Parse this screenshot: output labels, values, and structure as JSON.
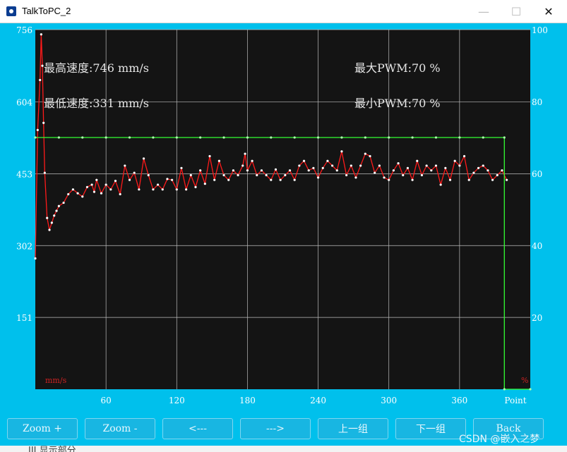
{
  "window": {
    "title": "TalkToPC_2",
    "controls": {
      "minimize": "—",
      "maximize": "☐",
      "close": "✕"
    }
  },
  "stats": {
    "max_speed": "最高速度:746 mm/s",
    "min_speed": "最低速度:331 mm/s",
    "max_pwm": "最大PWM:70 %",
    "min_pwm": "最小PWM:70 %"
  },
  "chart_data": {
    "type": "line",
    "left_axis": {
      "unit_label": "mm/s",
      "ticks": [
        "151",
        "302",
        "453",
        "604",
        "756"
      ],
      "range": [
        0,
        756
      ]
    },
    "right_axis": {
      "unit_label": "%",
      "ticks": [
        "20",
        "40",
        "60",
        "80",
        "100"
      ],
      "range": [
        0,
        100
      ]
    },
    "x_axis": {
      "ticks": [
        "60",
        "120",
        "180",
        "240",
        "300",
        "360"
      ],
      "end_label": "Point",
      "range": [
        0,
        420
      ]
    },
    "grid": true,
    "series": [
      {
        "axis": "left",
        "color": "#ff1a1a",
        "x": [
          0,
          2,
          4,
          5,
          6,
          7,
          8,
          10,
          12,
          14,
          16,
          18,
          20,
          24,
          28,
          32,
          36,
          40,
          44,
          48,
          50,
          52,
          56,
          60,
          64,
          68,
          72,
          76,
          80,
          84,
          88,
          92,
          96,
          100,
          104,
          108,
          112,
          116,
          120,
          124,
          128,
          132,
          136,
          140,
          144,
          148,
          152,
          156,
          160,
          164,
          168,
          172,
          176,
          178,
          180,
          184,
          188,
          192,
          196,
          200,
          204,
          208,
          212,
          216,
          220,
          224,
          228,
          232,
          236,
          240,
          244,
          248,
          252,
          256,
          260,
          264,
          268,
          272,
          276,
          280,
          284,
          288,
          292,
          296,
          300,
          304,
          308,
          312,
          316,
          320,
          324,
          328,
          332,
          336,
          340,
          344,
          348,
          352,
          356,
          360,
          364,
          368,
          372,
          376,
          380,
          384,
          388,
          392,
          396,
          400
        ],
        "y": [
          275,
          545,
          650,
          746,
          680,
          560,
          455,
          360,
          335,
          350,
          365,
          375,
          385,
          392,
          410,
          420,
          412,
          405,
          425,
          430,
          415,
          440,
          412,
          430,
          420,
          438,
          410,
          470,
          440,
          455,
          420,
          485,
          450,
          420,
          430,
          420,
          442,
          440,
          420,
          465,
          420,
          450,
          425,
          460,
          432,
          490,
          440,
          480,
          450,
          440,
          460,
          450,
          470,
          495,
          460,
          480,
          450,
          460,
          450,
          440,
          462,
          440,
          450,
          460,
          440,
          470,
          480,
          460,
          465,
          445,
          465,
          480,
          470,
          460,
          500,
          450,
          470,
          445,
          470,
          495,
          490,
          455,
          470,
          445,
          440,
          460,
          475,
          450,
          465,
          440,
          480,
          450,
          470,
          460,
          470,
          430,
          465,
          440,
          480,
          470,
          490,
          440,
          455,
          465,
          470,
          460,
          440,
          450,
          460,
          440
        ]
      },
      {
        "axis": "right",
        "color": "#33ff33",
        "x": [
          0,
          20,
          40,
          60,
          80,
          100,
          120,
          140,
          160,
          180,
          200,
          220,
          240,
          260,
          280,
          300,
          320,
          340,
          360,
          380,
          398,
          398,
          420
        ],
        "y": [
          70,
          70,
          70,
          70,
          70,
          70,
          70,
          70,
          70,
          70,
          70,
          70,
          70,
          70,
          70,
          70,
          70,
          70,
          70,
          70,
          70,
          0,
          0
        ]
      }
    ]
  },
  "buttons": {
    "zoom_in": "Zoom +",
    "zoom_out": "Zoom -",
    "prev": "<---",
    "next": "--->",
    "prev_group": "上一组",
    "next_group": "下一组",
    "back": "Back"
  },
  "watermark": "CSDN @嵌入之梦",
  "below_text": "III 显示部分"
}
